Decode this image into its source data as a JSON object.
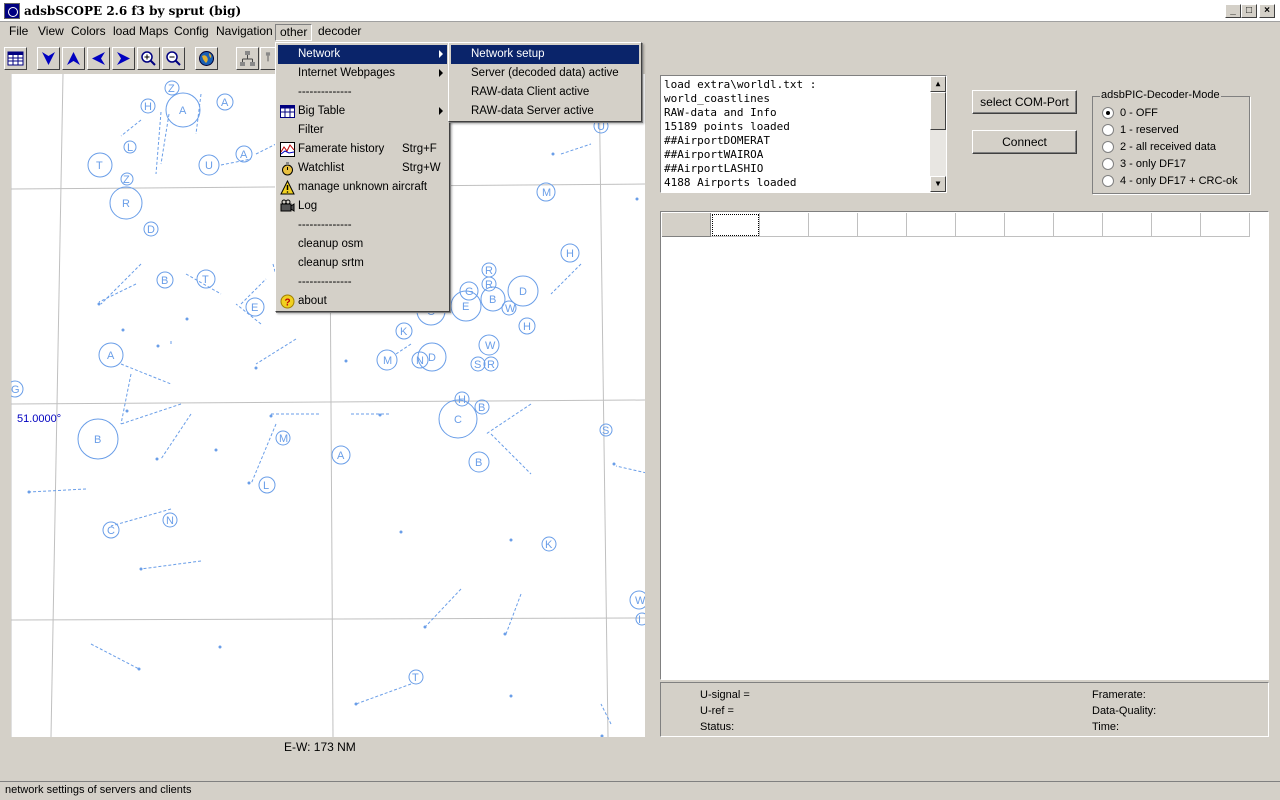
{
  "window": {
    "title": "adsbSCOPE 2.6 f3 by sprut  (big)"
  },
  "menubar": [
    "File",
    "View",
    "Colors",
    "load Maps",
    "Config",
    "Navigation",
    "other",
    "decoder"
  ],
  "toolbar_icons": [
    "table-icon",
    "arrow-down-icon",
    "arrow-up-icon",
    "arrow-left-icon",
    "arrow-right-icon",
    "zoom-in-icon",
    "zoom-out-icon",
    "globe-icon",
    "network-icon",
    "network-icon-2"
  ],
  "other_menu": {
    "items": [
      {
        "label": "Network",
        "submenu": true,
        "highlighted": true
      },
      {
        "label": "Internet Webpages",
        "submenu": true
      },
      {
        "label": "--------------"
      },
      {
        "label": "Big Table",
        "submenu": true,
        "icon": "table-icon"
      },
      {
        "label": "Filter"
      },
      {
        "label": "Famerate history",
        "shortcut": "Strg+F",
        "icon": "chart-icon"
      },
      {
        "label": "Watchlist",
        "shortcut": "Strg+W",
        "icon": "watch-icon"
      },
      {
        "label": "manage unknown aircraft",
        "icon": "warning-icon"
      },
      {
        "label": "Log",
        "icon": "camera-icon"
      },
      {
        "label": "--------------"
      },
      {
        "label": "cleanup osm"
      },
      {
        "label": "cleanup srtm"
      },
      {
        "label": "--------------"
      },
      {
        "label": "about",
        "icon": "help-icon"
      }
    ]
  },
  "network_submenu": {
    "items": [
      {
        "label": "Network setup",
        "highlighted": true
      },
      {
        "label": "Server (decoded data) active"
      },
      {
        "label": "RAW-data Client active"
      },
      {
        "label": "RAW-data Server active"
      }
    ]
  },
  "map": {
    "latitude_label": "51.0000°",
    "scale_label": "E-W: 173 NM",
    "accent_color": "#6a9ee8"
  },
  "log": {
    "lines": [
      "load extra\\worldl.txt :",
      "world_coastlines",
      "RAW-data and Info",
      "15189 points loaded",
      "##AirportDOMERAT",
      "##AirportWAIROA",
      "##AirportLASHIO",
      "4188 Airports loaded"
    ]
  },
  "buttons": {
    "com_port": "select COM-Port",
    "connect": "Connect"
  },
  "decoder_mode": {
    "legend": "adsbPIC-Decoder-Mode",
    "options": [
      "0 - OFF",
      "1 - reserved",
      "2 - all received data",
      "3 - only DF17",
      "4 - only DF17 + CRC-ok"
    ],
    "selected": 0
  },
  "status": {
    "u_signal": "U-signal =",
    "u_ref": "U-ref =",
    "status": "Status:",
    "framerate": "Framerate:",
    "data_quality": "Data-Quality:",
    "time": "Time:"
  },
  "statusbar": {
    "text": "network settings of servers and clients"
  }
}
